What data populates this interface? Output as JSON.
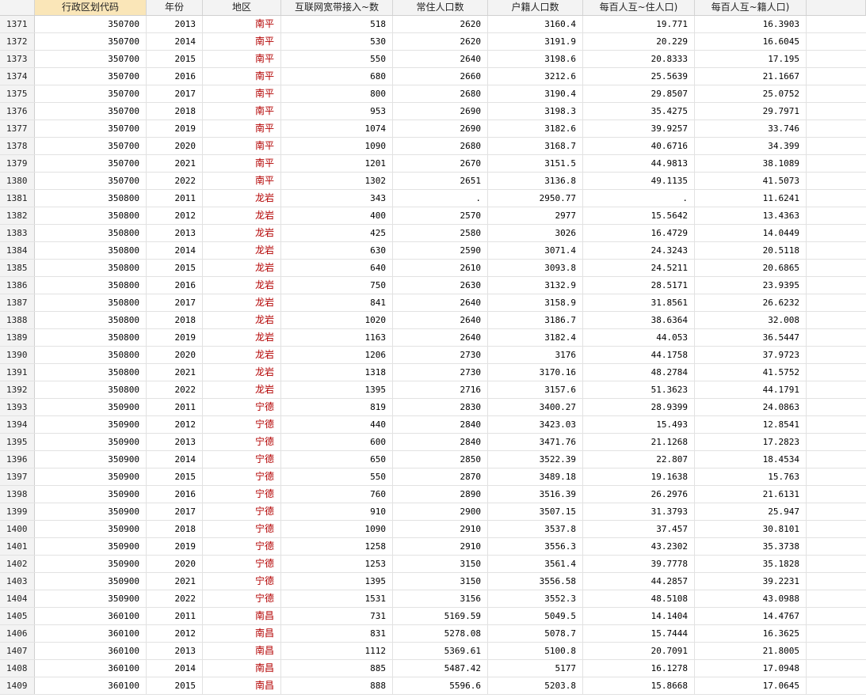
{
  "headers": [
    "行政区划代码",
    "年份",
    "地区",
    "互联网宽带接入~数",
    "常住人口数",
    "户籍人口数",
    "每百人互~住人口)",
    "每百人互~籍人口)"
  ],
  "rows": [
    {
      "n": "1371",
      "code": "350700",
      "year": "2013",
      "region": "南平",
      "net": "518",
      "res": "2620",
      "hh": "3160.4",
      "r1": "19.771",
      "r2": "16.3903"
    },
    {
      "n": "1372",
      "code": "350700",
      "year": "2014",
      "region": "南平",
      "net": "530",
      "res": "2620",
      "hh": "3191.9",
      "r1": "20.229",
      "r2": "16.6045"
    },
    {
      "n": "1373",
      "code": "350700",
      "year": "2015",
      "region": "南平",
      "net": "550",
      "res": "2640",
      "hh": "3198.6",
      "r1": "20.8333",
      "r2": "17.195"
    },
    {
      "n": "1374",
      "code": "350700",
      "year": "2016",
      "region": "南平",
      "net": "680",
      "res": "2660",
      "hh": "3212.6",
      "r1": "25.5639",
      "r2": "21.1667"
    },
    {
      "n": "1375",
      "code": "350700",
      "year": "2017",
      "region": "南平",
      "net": "800",
      "res": "2680",
      "hh": "3190.4",
      "r1": "29.8507",
      "r2": "25.0752"
    },
    {
      "n": "1376",
      "code": "350700",
      "year": "2018",
      "region": "南平",
      "net": "953",
      "res": "2690",
      "hh": "3198.3",
      "r1": "35.4275",
      "r2": "29.7971"
    },
    {
      "n": "1377",
      "code": "350700",
      "year": "2019",
      "region": "南平",
      "net": "1074",
      "res": "2690",
      "hh": "3182.6",
      "r1": "39.9257",
      "r2": "33.746"
    },
    {
      "n": "1378",
      "code": "350700",
      "year": "2020",
      "region": "南平",
      "net": "1090",
      "res": "2680",
      "hh": "3168.7",
      "r1": "40.6716",
      "r2": "34.399"
    },
    {
      "n": "1379",
      "code": "350700",
      "year": "2021",
      "region": "南平",
      "net": "1201",
      "res": "2670",
      "hh": "3151.5",
      "r1": "44.9813",
      "r2": "38.1089"
    },
    {
      "n": "1380",
      "code": "350700",
      "year": "2022",
      "region": "南平",
      "net": "1302",
      "res": "2651",
      "hh": "3136.8",
      "r1": "49.1135",
      "r2": "41.5073"
    },
    {
      "n": "1381",
      "code": "350800",
      "year": "2011",
      "region": "龙岩",
      "net": "343",
      "res": ".",
      "hh": "2950.77",
      "r1": ".",
      "r2": "11.6241"
    },
    {
      "n": "1382",
      "code": "350800",
      "year": "2012",
      "region": "龙岩",
      "net": "400",
      "res": "2570",
      "hh": "2977",
      "r1": "15.5642",
      "r2": "13.4363"
    },
    {
      "n": "1383",
      "code": "350800",
      "year": "2013",
      "region": "龙岩",
      "net": "425",
      "res": "2580",
      "hh": "3026",
      "r1": "16.4729",
      "r2": "14.0449"
    },
    {
      "n": "1384",
      "code": "350800",
      "year": "2014",
      "region": "龙岩",
      "net": "630",
      "res": "2590",
      "hh": "3071.4",
      "r1": "24.3243",
      "r2": "20.5118"
    },
    {
      "n": "1385",
      "code": "350800",
      "year": "2015",
      "region": "龙岩",
      "net": "640",
      "res": "2610",
      "hh": "3093.8",
      "r1": "24.5211",
      "r2": "20.6865"
    },
    {
      "n": "1386",
      "code": "350800",
      "year": "2016",
      "region": "龙岩",
      "net": "750",
      "res": "2630",
      "hh": "3132.9",
      "r1": "28.5171",
      "r2": "23.9395"
    },
    {
      "n": "1387",
      "code": "350800",
      "year": "2017",
      "region": "龙岩",
      "net": "841",
      "res": "2640",
      "hh": "3158.9",
      "r1": "31.8561",
      "r2": "26.6232"
    },
    {
      "n": "1388",
      "code": "350800",
      "year": "2018",
      "region": "龙岩",
      "net": "1020",
      "res": "2640",
      "hh": "3186.7",
      "r1": "38.6364",
      "r2": "32.008"
    },
    {
      "n": "1389",
      "code": "350800",
      "year": "2019",
      "region": "龙岩",
      "net": "1163",
      "res": "2640",
      "hh": "3182.4",
      "r1": "44.053",
      "r2": "36.5447"
    },
    {
      "n": "1390",
      "code": "350800",
      "year": "2020",
      "region": "龙岩",
      "net": "1206",
      "res": "2730",
      "hh": "3176",
      "r1": "44.1758",
      "r2": "37.9723"
    },
    {
      "n": "1391",
      "code": "350800",
      "year": "2021",
      "region": "龙岩",
      "net": "1318",
      "res": "2730",
      "hh": "3170.16",
      "r1": "48.2784",
      "r2": "41.5752"
    },
    {
      "n": "1392",
      "code": "350800",
      "year": "2022",
      "region": "龙岩",
      "net": "1395",
      "res": "2716",
      "hh": "3157.6",
      "r1": "51.3623",
      "r2": "44.1791"
    },
    {
      "n": "1393",
      "code": "350900",
      "year": "2011",
      "region": "宁德",
      "net": "819",
      "res": "2830",
      "hh": "3400.27",
      "r1": "28.9399",
      "r2": "24.0863"
    },
    {
      "n": "1394",
      "code": "350900",
      "year": "2012",
      "region": "宁德",
      "net": "440",
      "res": "2840",
      "hh": "3423.03",
      "r1": "15.493",
      "r2": "12.8541"
    },
    {
      "n": "1395",
      "code": "350900",
      "year": "2013",
      "region": "宁德",
      "net": "600",
      "res": "2840",
      "hh": "3471.76",
      "r1": "21.1268",
      "r2": "17.2823"
    },
    {
      "n": "1396",
      "code": "350900",
      "year": "2014",
      "region": "宁德",
      "net": "650",
      "res": "2850",
      "hh": "3522.39",
      "r1": "22.807",
      "r2": "18.4534"
    },
    {
      "n": "1397",
      "code": "350900",
      "year": "2015",
      "region": "宁德",
      "net": "550",
      "res": "2870",
      "hh": "3489.18",
      "r1": "19.1638",
      "r2": "15.763"
    },
    {
      "n": "1398",
      "code": "350900",
      "year": "2016",
      "region": "宁德",
      "net": "760",
      "res": "2890",
      "hh": "3516.39",
      "r1": "26.2976",
      "r2": "21.6131"
    },
    {
      "n": "1399",
      "code": "350900",
      "year": "2017",
      "region": "宁德",
      "net": "910",
      "res": "2900",
      "hh": "3507.15",
      "r1": "31.3793",
      "r2": "25.947"
    },
    {
      "n": "1400",
      "code": "350900",
      "year": "2018",
      "region": "宁德",
      "net": "1090",
      "res": "2910",
      "hh": "3537.8",
      "r1": "37.457",
      "r2": "30.8101"
    },
    {
      "n": "1401",
      "code": "350900",
      "year": "2019",
      "region": "宁德",
      "net": "1258",
      "res": "2910",
      "hh": "3556.3",
      "r1": "43.2302",
      "r2": "35.3738"
    },
    {
      "n": "1402",
      "code": "350900",
      "year": "2020",
      "region": "宁德",
      "net": "1253",
      "res": "3150",
      "hh": "3561.4",
      "r1": "39.7778",
      "r2": "35.1828"
    },
    {
      "n": "1403",
      "code": "350900",
      "year": "2021",
      "region": "宁德",
      "net": "1395",
      "res": "3150",
      "hh": "3556.58",
      "r1": "44.2857",
      "r2": "39.2231"
    },
    {
      "n": "1404",
      "code": "350900",
      "year": "2022",
      "region": "宁德",
      "net": "1531",
      "res": "3156",
      "hh": "3552.3",
      "r1": "48.5108",
      "r2": "43.0988"
    },
    {
      "n": "1405",
      "code": "360100",
      "year": "2011",
      "region": "南昌",
      "net": "731",
      "res": "5169.59",
      "hh": "5049.5",
      "r1": "14.1404",
      "r2": "14.4767"
    },
    {
      "n": "1406",
      "code": "360100",
      "year": "2012",
      "region": "南昌",
      "net": "831",
      "res": "5278.08",
      "hh": "5078.7",
      "r1": "15.7444",
      "r2": "16.3625"
    },
    {
      "n": "1407",
      "code": "360100",
      "year": "2013",
      "region": "南昌",
      "net": "1112",
      "res": "5369.61",
      "hh": "5100.8",
      "r1": "20.7091",
      "r2": "21.8005"
    },
    {
      "n": "1408",
      "code": "360100",
      "year": "2014",
      "region": "南昌",
      "net": "885",
      "res": "5487.42",
      "hh": "5177",
      "r1": "16.1278",
      "r2": "17.0948"
    },
    {
      "n": "1409",
      "code": "360100",
      "year": "2015",
      "region": "南昌",
      "net": "888",
      "res": "5596.6",
      "hh": "5203.8",
      "r1": "15.8668",
      "r2": "17.0645"
    }
  ]
}
